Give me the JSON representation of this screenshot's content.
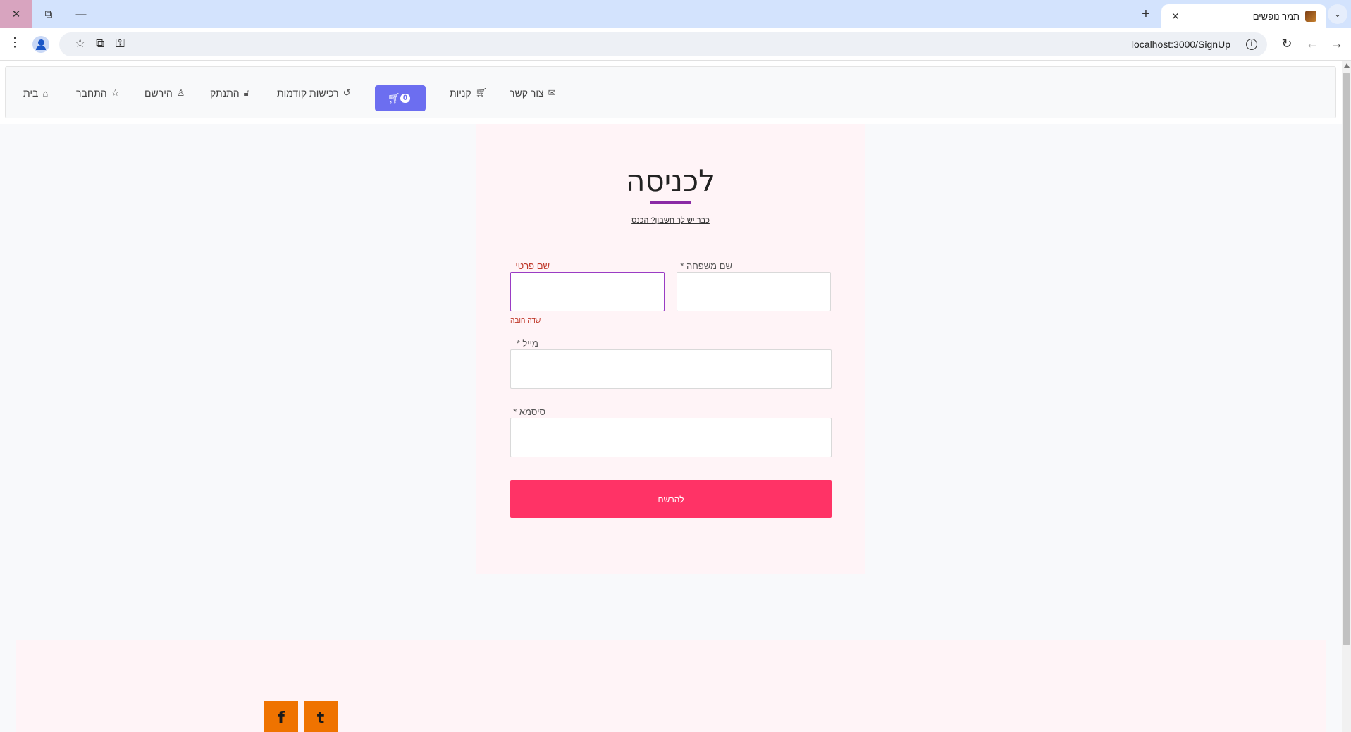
{
  "browser": {
    "tab_title": "תמר נופשים",
    "url": "localhost:3000/SignUp",
    "window_controls": {
      "close": "✕",
      "restore": "⧉",
      "minimize": "—"
    },
    "icons": {
      "new_tab": "+",
      "tab_close": "✕",
      "tab_menu": "⌄",
      "kebab": "⋮",
      "bookmark": "☆",
      "translate": "⧉",
      "password": "⚿",
      "info": "i",
      "reload": "↻",
      "back": "←",
      "forward": "→"
    }
  },
  "nav": {
    "items": [
      {
        "label": "בית",
        "icon": "home-icon",
        "glyph": "⌂"
      },
      {
        "label": "התחבר",
        "icon": "star-icon",
        "glyph": "☆"
      },
      {
        "label": "הירשם",
        "icon": "user-icon",
        "glyph": "♙"
      },
      {
        "label": "התנתק",
        "icon": "unlock-icon",
        "glyph": "🔓︎"
      },
      {
        "label": "רכישות קודמות",
        "icon": "history-icon",
        "glyph": "↺"
      },
      {
        "label": "קניות",
        "icon": "cart-icon",
        "glyph": "🛒︎"
      },
      {
        "label": "צור קשר",
        "icon": "envelope-icon",
        "glyph": "✉"
      }
    ],
    "cart_count": "0",
    "cart_glyph": "🛒︎"
  },
  "form": {
    "title": "לכניסה",
    "login_link": "כבר יש לך חשבון? הכנס",
    "first_name_label": "שם פרטי *",
    "last_name_label": "שם משפחה *",
    "email_label": "מייל *",
    "password_label": "סיסמא *",
    "required_error": "שדה חובה",
    "submit_label": "להרשם"
  },
  "footer": {
    "social": [
      {
        "name": "facebook-icon",
        "glyph": "f"
      },
      {
        "name": "tumblr-icon",
        "glyph": "t"
      }
    ]
  },
  "colors": {
    "accent": "#9a3cc4",
    "cart_button": "#6c6ef0",
    "submit_button": "#ff3366",
    "error": "#c0392b",
    "social": "#ef7300"
  }
}
